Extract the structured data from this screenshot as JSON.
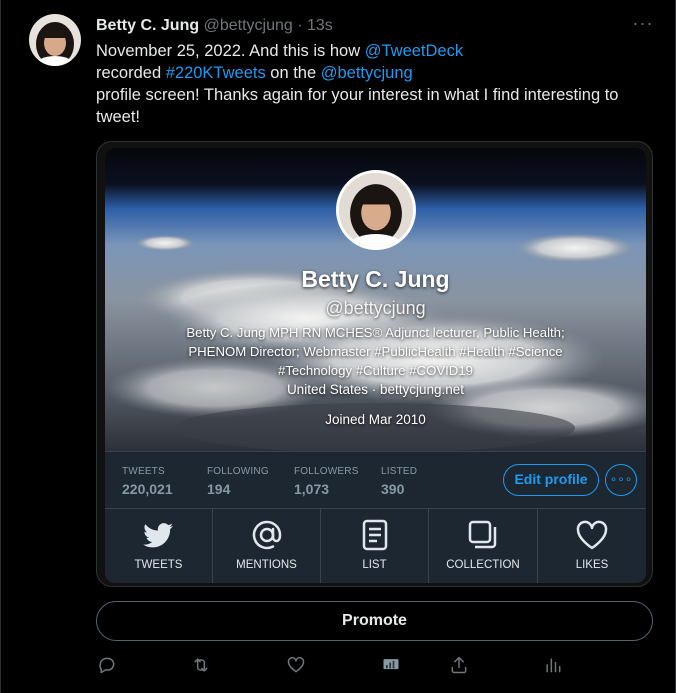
{
  "tweet": {
    "author_name": "Betty C. Jung",
    "author_handle": "@bettycjung",
    "separator": " · ",
    "time": "13s",
    "more_label": "···",
    "text_parts": {
      "t1": "November 25, 2022. And this is how ",
      "l1": "@TweetDeck",
      "t2": "recorded ",
      "l2": "#220KTweets",
      "t3": " on the ",
      "l3": "@bettycjung",
      "t4": "profile screen! Thanks again for your interest in what I find interesting to tweet!"
    }
  },
  "profile_card": {
    "name": "Betty C. Jung",
    "handle": "@bettycjung",
    "bio": "Betty C. Jung MPH RN MCHES® Adjunct lecturer, Public Health; PHENOM Director; Webmaster #PublicHealth #Health #Science #Technology #Culture #COVID19",
    "location_line": "United States  ·  bettycjung.net",
    "joined": "Joined Mar 2010",
    "stats": [
      {
        "label": "TWEETS",
        "value": "220,021"
      },
      {
        "label": "FOLLOWING",
        "value": "194"
      },
      {
        "label": "FOLLOWERS",
        "value": "1,073"
      },
      {
        "label": "LISTED",
        "value": "390"
      }
    ],
    "edit_profile_label": "Edit profile",
    "more_label": "∘∘∘",
    "tabs": [
      {
        "label": "TWEETS",
        "icon": "twitter-bird-icon"
      },
      {
        "label": "MENTIONS",
        "icon": "at-sign-icon"
      },
      {
        "label": "LIST",
        "icon": "list-icon"
      },
      {
        "label": "COLLECTION",
        "icon": "collection-icon"
      },
      {
        "label": "LIKES",
        "icon": "heart-icon"
      }
    ]
  },
  "promote_label": "Promote",
  "actions": [
    "reply-icon",
    "retweet-icon",
    "like-icon",
    "analytics-icon",
    "share-icon",
    "views-icon"
  ],
  "colors": {
    "accent": "#1d9bf0",
    "background": "#000000",
    "text": "#e7e9ea",
    "muted": "#71767b",
    "card_bg": "#1c2732"
  }
}
